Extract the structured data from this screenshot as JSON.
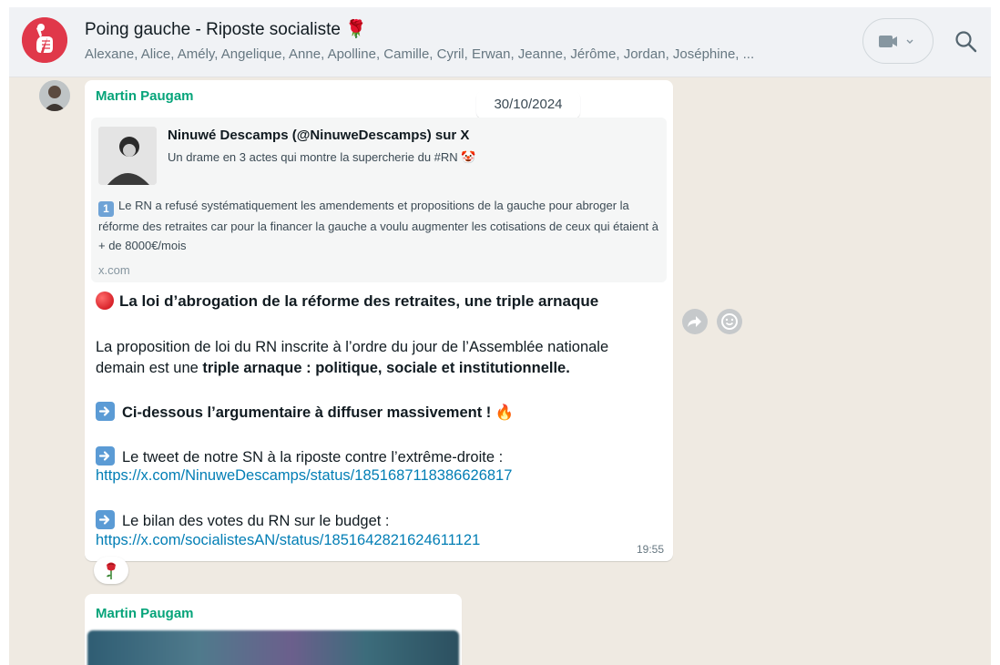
{
  "header": {
    "title": "Poing gauche - Riposte socialiste 🌹",
    "members": "Alexane, Alice, Amély, Angelique, Anne, Apolline, Camille, Cyril, Erwan, Jeanne, Jérôme, Jordan, Joséphine, ...",
    "video_icon": "video-call-icon",
    "search_icon": "search-icon"
  },
  "message": {
    "sender": "Martin Paugam",
    "date_pill": "30/10/2024",
    "link_preview": {
      "title": "Ninuwé Descamps (@NinuweDescamps) sur X",
      "subtitle": "Un drame en 3 actes qui montre la supercherie du #RN 🤡",
      "badge": "1",
      "body": "Le RN a refusé systématiquement les amendements et propositions de la gauche pour abroger la réforme des retraites car pour la financer la gauche a voulu augmenter les cotisations de ceux qui étaient à + de 8000€/mois",
      "domain": "x.com"
    },
    "headline": "La loi d’abrogation de la réforme des retraites, une triple arnaque",
    "para1_a": "La proposition de loi du RN inscrite à l’ordre du jour de l’Assemblée nationale",
    "para1_b": "demain est une ",
    "para1_bold": "triple arnaque : politique, sociale et institutionnelle.",
    "callout": "Ci-dessous l’argumentaire à diffuser massivement ! 🔥",
    "tweet_label": "Le tweet de notre SN à la riposte contre l’extrême-droite :",
    "tweet_link": "https://x.com/NinuweDescamps/status/1851687118386626817",
    "votes_label": "Le bilan des votes du RN sur le budget :",
    "votes_link": "https://x.com/socialistesAN/status/1851642821624611121",
    "time": "19:55",
    "reaction": "🌹"
  },
  "message2": {
    "sender": "Martin Paugam"
  },
  "colors": {
    "sender_green": "#06a47a",
    "link_blue": "#027eb5",
    "chat_bg": "#efeae2",
    "header_bg": "#f0f2f5"
  }
}
